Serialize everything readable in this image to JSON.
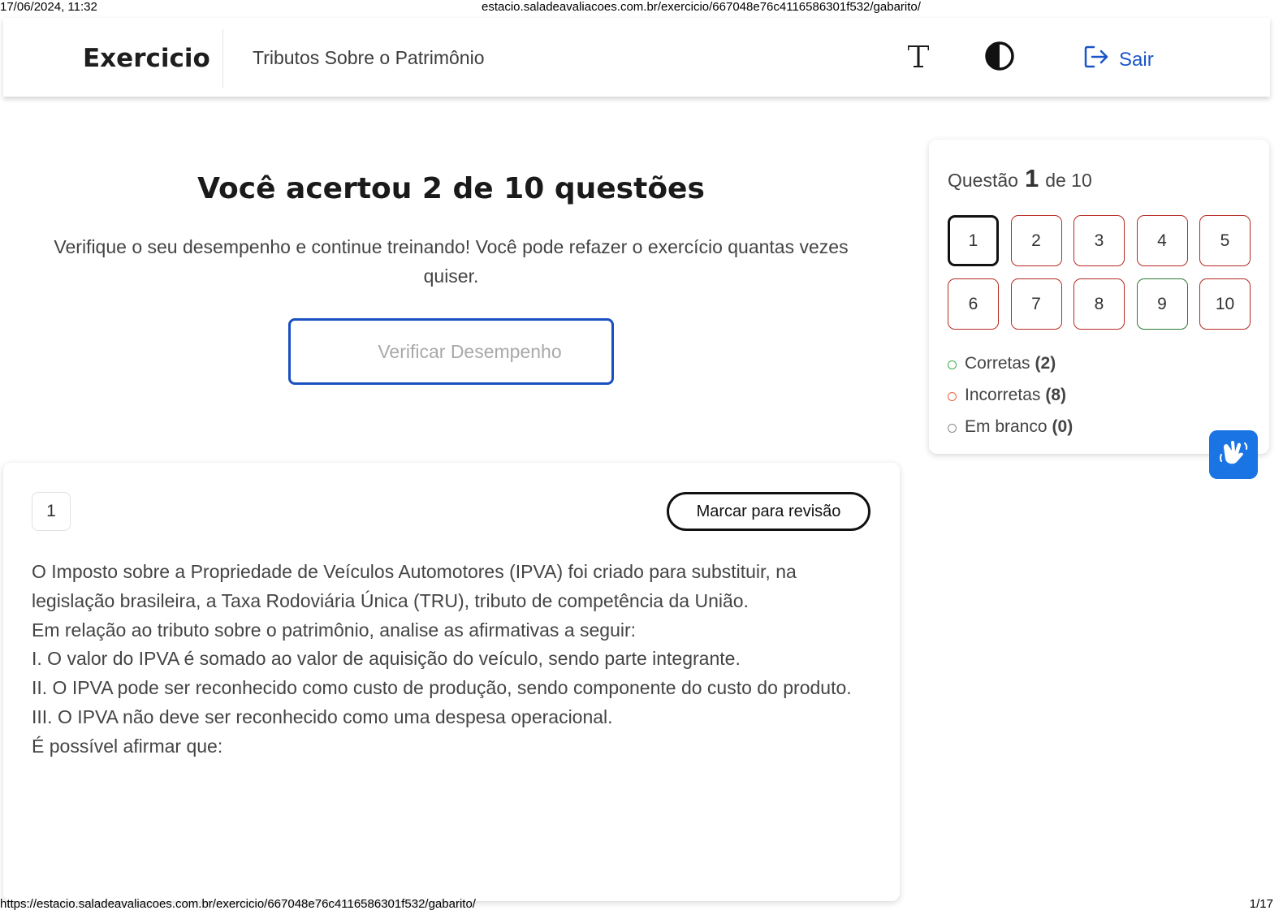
{
  "print": {
    "datetime": "17/06/2024, 11:32",
    "header_url": "estacio.saladeavaliacoes.com.br/exercicio/667048e76c4116586301f532/gabarito/",
    "footer_url": "https://estacio.saladeavaliacoes.com.br/exercicio/667048e76c4116586301f532/gabarito/",
    "page": "1/17"
  },
  "header": {
    "brand": "Exercicio",
    "subject": "Tributos Sobre o Patrimônio",
    "font_icon": "font-size-icon",
    "contrast_icon": "contrast-icon",
    "logout_icon": "logout-icon",
    "logout_label": "Sair"
  },
  "result": {
    "title": "Você acertou 2 de 10 questões",
    "description": "Verifique o seu desempenho e continue treinando! Você pode refazer o exercício quantas vezes quiser.",
    "verify_label": "Verificar Desempenho"
  },
  "navigator": {
    "prefix": "Questão",
    "current": "1",
    "suffix": "de 10",
    "questions": [
      {
        "label": "1",
        "status": "incorrect",
        "current": true
      },
      {
        "label": "2",
        "status": "incorrect",
        "current": false
      },
      {
        "label": "3",
        "status": "incorrect",
        "current": false
      },
      {
        "label": "4",
        "status": "incorrect",
        "current": false
      },
      {
        "label": "5",
        "status": "incorrect",
        "current": false
      },
      {
        "label": "6",
        "status": "incorrect",
        "current": false
      },
      {
        "label": "7",
        "status": "incorrect",
        "current": false
      },
      {
        "label": "8",
        "status": "incorrect",
        "current": false
      },
      {
        "label": "9",
        "status": "correct",
        "current": false
      },
      {
        "label": "10",
        "status": "incorrect",
        "current": false
      }
    ],
    "legend": [
      {
        "label": "Corretas",
        "count": "(2)",
        "color": "#3fae49"
      },
      {
        "label": "Incorretas",
        "count": "(8)",
        "color": "#e8673c"
      },
      {
        "label": "Em branco",
        "count": "(0)",
        "color": "#8a8a8a"
      }
    ]
  },
  "accessibility": {
    "vlibras_icon": "sign-language-icon",
    "color": "#1b74e4"
  },
  "question": {
    "number": "1",
    "review_label": "Marcar para revisão",
    "paragraphs": [
      "O Imposto sobre a Propriedade de Veículos Automotores (IPVA) foi criado para substituir, na legislação brasileira, a Taxa Rodoviária Única (TRU), tributo de competência da União.",
      "Em relação ao tributo sobre o patrimônio, analise as afirmativas a seguir:",
      "I. O valor do IPVA é somado ao valor de aquisição do veículo, sendo parte integrante.",
      "II. O IPVA pode ser reconhecido como custo de produção, sendo componente do custo do produto.",
      "III. O IPVA não deve ser reconhecido como uma despesa operacional.",
      "É possível afirmar que:"
    ]
  },
  "colors": {
    "accent": "#1a56c9",
    "incorrect_border": "#b52a22",
    "correct_border": "#2d7a33"
  }
}
